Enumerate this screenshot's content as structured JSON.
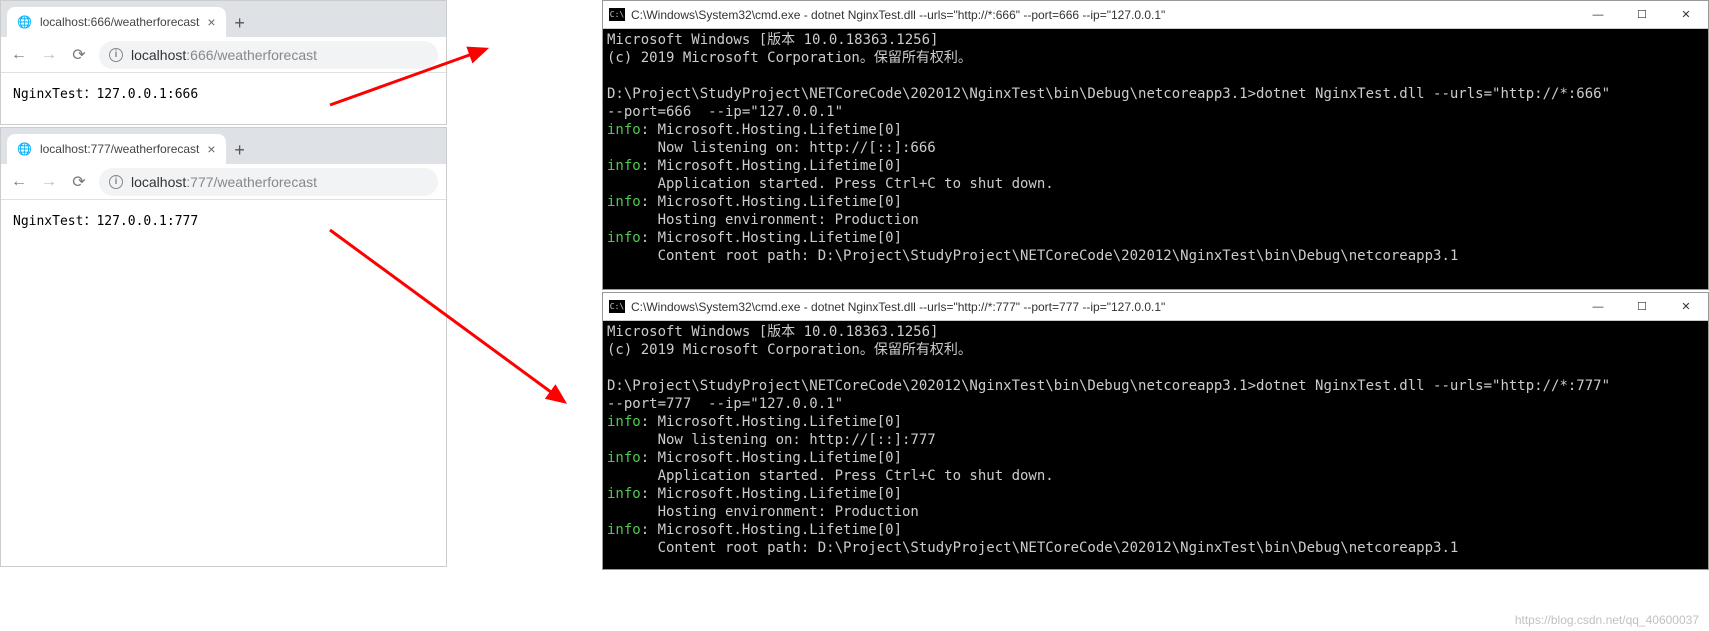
{
  "browser1": {
    "tab_title": "localhost:666/weatherforecast",
    "url_host": "localhost",
    "url_port_path": ":666/weatherforecast",
    "body": "NginxTest：127.0.0.1:666"
  },
  "browser2": {
    "tab_title": "localhost:777/weatherforecast",
    "url_host": "localhost",
    "url_port_path": ":777/weatherforecast",
    "body": "NginxTest：127.0.0.1:777"
  },
  "cmd1": {
    "title": "C:\\Windows\\System32\\cmd.exe - dotnet  NginxTest.dll --urls=\"http://*:666\" --port=666  --ip=\"127.0.0.1\"",
    "l1": "Microsoft Windows [版本 10.0.18363.1256]",
    "l2": "(c) 2019 Microsoft Corporation。保留所有权利。",
    "l3": "D:\\Project\\StudyProject\\NETCoreCode\\202012\\NginxTest\\bin\\Debug\\netcoreapp3.1>dotnet NginxTest.dll --urls=\"http://*:666\"",
    "l4": "--port=666  --ip=\"127.0.0.1\"",
    "i1": "info",
    "l5": ": Microsoft.Hosting.Lifetime[0]",
    "l6": "      Now listening on: http://[::]:666",
    "i2": "info",
    "l7": ": Microsoft.Hosting.Lifetime[0]",
    "l8": "      Application started. Press Ctrl+C to shut down.",
    "i3": "info",
    "l9": ": Microsoft.Hosting.Lifetime[0]",
    "l10": "      Hosting environment: Production",
    "i4": "info",
    "l11": ": Microsoft.Hosting.Lifetime[0]",
    "l12": "      Content root path: D:\\Project\\StudyProject\\NETCoreCode\\202012\\NginxTest\\bin\\Debug\\netcoreapp3.1"
  },
  "cmd2": {
    "title": "C:\\Windows\\System32\\cmd.exe - dotnet  NginxTest.dll --urls=\"http://*:777\" --port=777  --ip=\"127.0.0.1\"",
    "l1": "Microsoft Windows [版本 10.0.18363.1256]",
    "l2": "(c) 2019 Microsoft Corporation。保留所有权利。",
    "l3": "D:\\Project\\StudyProject\\NETCoreCode\\202012\\NginxTest\\bin\\Debug\\netcoreapp3.1>dotnet NginxTest.dll --urls=\"http://*:777\"",
    "l4": "--port=777  --ip=\"127.0.0.1\"",
    "i1": "info",
    "l5": ": Microsoft.Hosting.Lifetime[0]",
    "l6": "      Now listening on: http://[::]:777",
    "i2": "info",
    "l7": ": Microsoft.Hosting.Lifetime[0]",
    "l8": "      Application started. Press Ctrl+C to shut down.",
    "i3": "info",
    "l9": ": Microsoft.Hosting.Lifetime[0]",
    "l10": "      Hosting environment: Production",
    "i4": "info",
    "l11": ": Microsoft.Hosting.Lifetime[0]",
    "l12": "      Content root path: D:\\Project\\StudyProject\\NETCoreCode\\202012\\NginxTest\\bin\\Debug\\netcoreapp3.1"
  },
  "watermark": "https://blog.csdn.net/qq_40600037"
}
